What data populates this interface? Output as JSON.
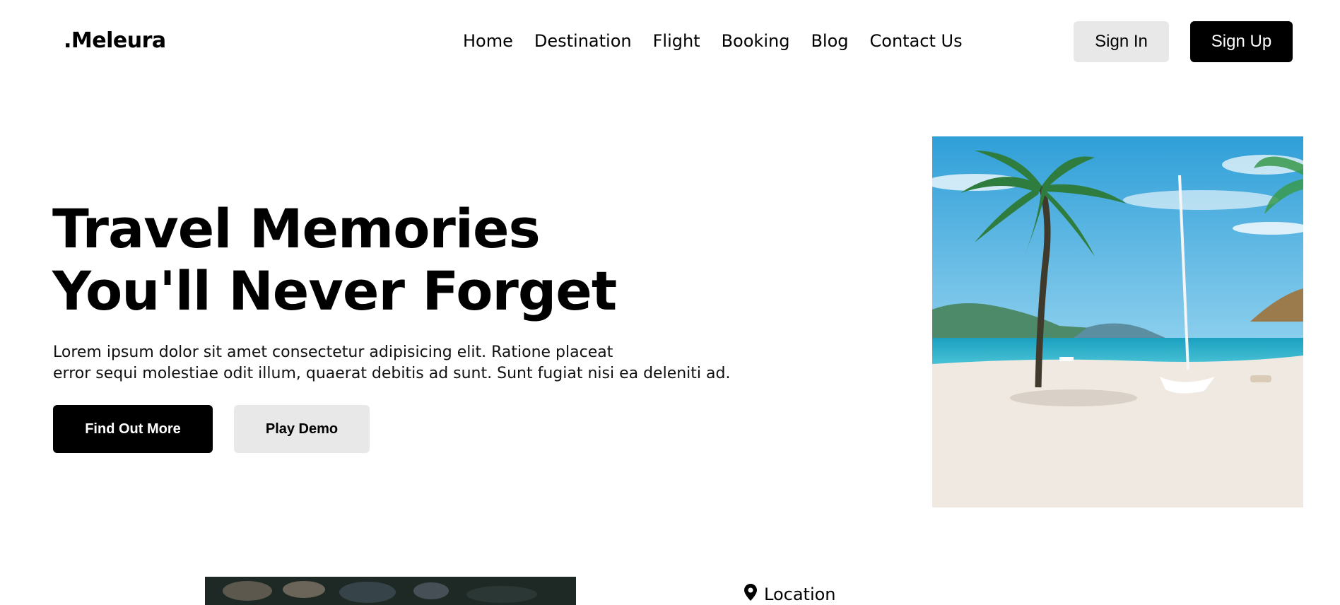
{
  "brand": {
    "logo": ".Meleura"
  },
  "nav": {
    "links": [
      "Home",
      "Destination",
      "Flight",
      "Booking",
      "Blog",
      "Contact Us"
    ],
    "sign_in": "Sign In",
    "sign_up": "Sign Up"
  },
  "hero": {
    "title_line1": "Travel Memories",
    "title_line2": "You'll Never Forget",
    "description_line1": "Lorem ipsum dolor sit amet consectetur adipisicing elit. Ratione placeat",
    "description_line2": "error sequi molestiae odit illum, quaerat debitis ad sunt. Sunt fugiat nisi ea deleniti ad.",
    "primary_button": "Find Out More",
    "secondary_button": "Play Demo"
  },
  "next_section": {
    "location_label": "Location"
  },
  "colors": {
    "primary": "#000000",
    "secondary_button_bg": "#e8e8e8",
    "background": "#ffffff"
  }
}
